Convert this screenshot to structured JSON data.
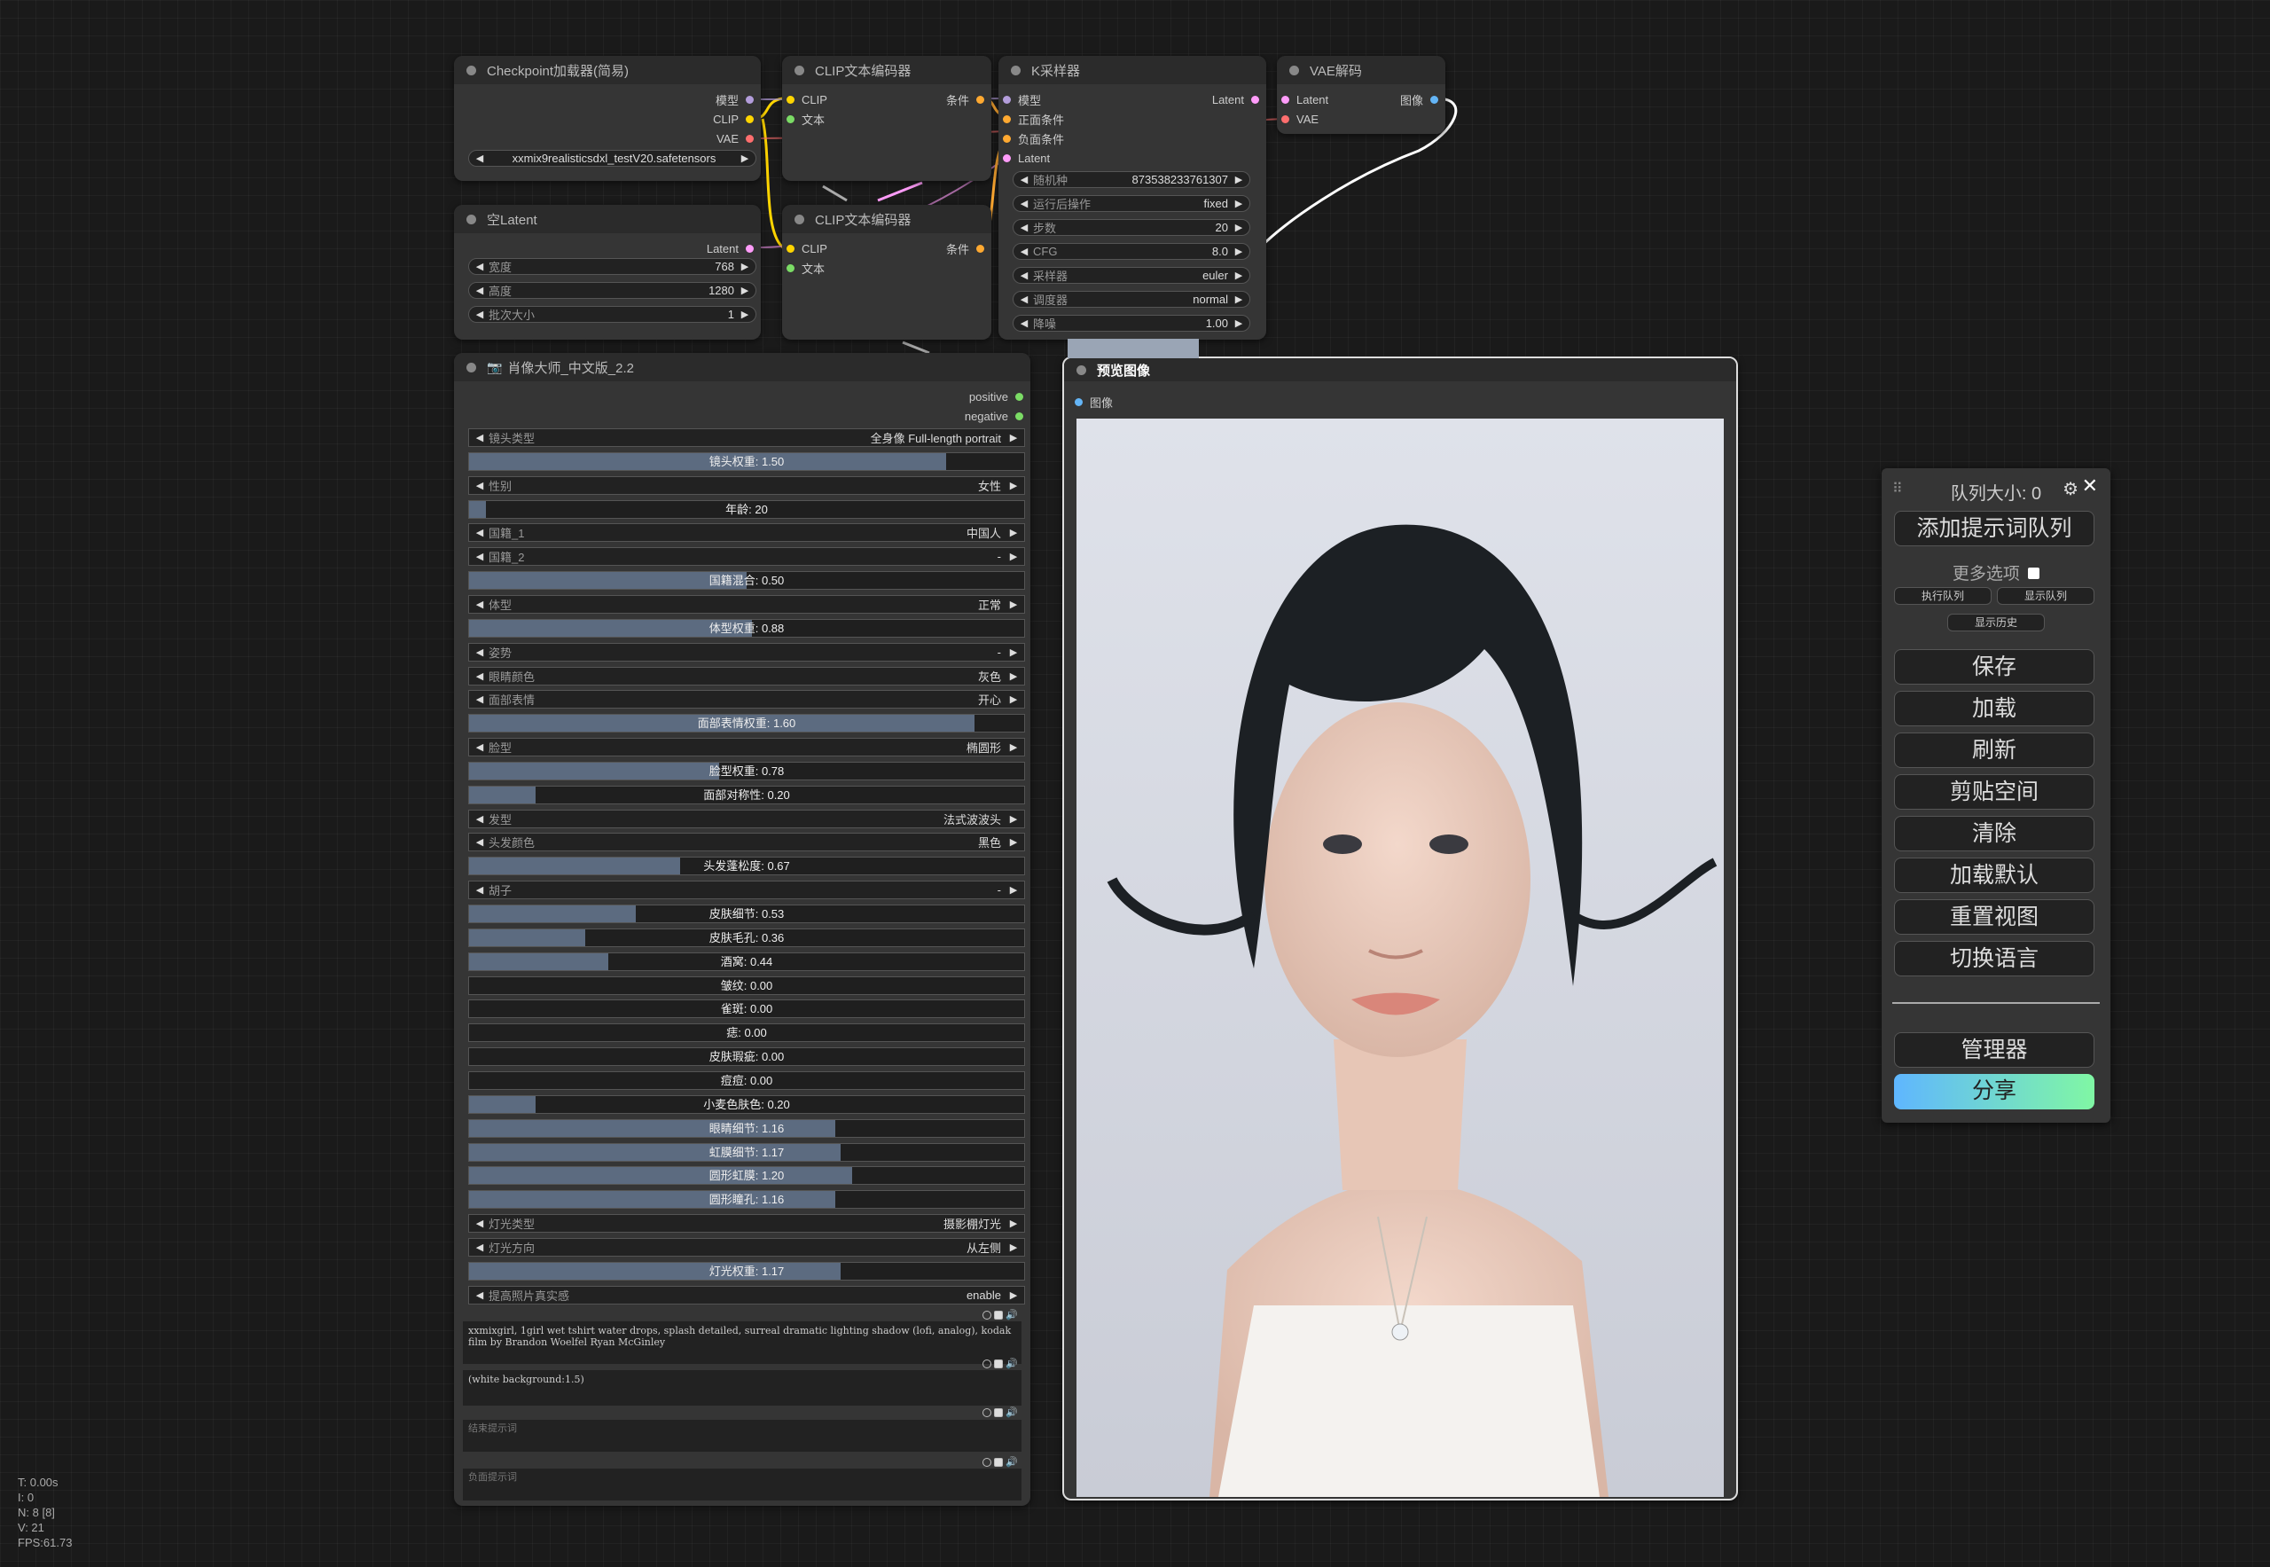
{
  "checkpoint_node": {
    "title": "Checkpoint加载器(简易)",
    "outputs": [
      "模型",
      "CLIP",
      "VAE"
    ],
    "ckpt_name": "xxmix9realisticsdxl_testV20.safetensors"
  },
  "clip_node_1": {
    "title": "CLIP文本编码器",
    "input_clip": "CLIP",
    "input_text": "文本",
    "output": "条件"
  },
  "clip_node_2": {
    "title": "CLIP文本编码器",
    "input_clip": "CLIP",
    "input_text": "文本",
    "output": "条件"
  },
  "ksampler_node": {
    "title": "K采样器",
    "inputs": [
      "模型",
      "正面条件",
      "负面条件",
      "Latent"
    ],
    "output": "Latent",
    "widgets": [
      {
        "label": "随机种",
        "value": "873538233761307"
      },
      {
        "label": "运行后操作",
        "value": "fixed"
      },
      {
        "label": "步数",
        "value": "20"
      },
      {
        "label": "CFG",
        "value": "8.0"
      },
      {
        "label": "采样器",
        "value": "euler"
      },
      {
        "label": "调度器",
        "value": "normal"
      },
      {
        "label": "降噪",
        "value": "1.00"
      }
    ]
  },
  "vae_node": {
    "title": "VAE解码",
    "inputs": [
      "Latent",
      "VAE"
    ],
    "output": "图像"
  },
  "latent_node": {
    "title": "空Latent",
    "output": "Latent",
    "widgets": [
      {
        "label": "宽度",
        "value": "768"
      },
      {
        "label": "高度",
        "value": "1280"
      },
      {
        "label": "批次大小",
        "value": "1"
      }
    ]
  },
  "portrait_node": {
    "title": "肖像大师_中文版_2.2",
    "outputs": [
      "positive",
      "negative"
    ],
    "rows": [
      {
        "kind": "combo",
        "label": "镜头类型",
        "value": "全身像 Full-length portrait"
      },
      {
        "kind": "slider",
        "text": "镜头权重: 1.50",
        "fill": 0.86
      },
      {
        "kind": "combo",
        "label": "性别",
        "value": "女性"
      },
      {
        "kind": "slider",
        "text": "年龄: 20",
        "fill": 0.03
      },
      {
        "kind": "combo",
        "label": "国籍_1",
        "value": "中国人"
      },
      {
        "kind": "combo",
        "label": "国籍_2",
        "value": "-"
      },
      {
        "kind": "slider",
        "text": "国籍混合: 0.50",
        "fill": 0.5
      },
      {
        "kind": "combo",
        "label": "体型",
        "value": "正常"
      },
      {
        "kind": "slider",
        "text": "体型权重: 0.88",
        "fill": 0.51
      },
      {
        "kind": "combo",
        "label": "姿势",
        "value": "-"
      },
      {
        "kind": "combo",
        "label": "眼睛颜色",
        "value": "灰色"
      },
      {
        "kind": "combo",
        "label": "面部表情",
        "value": "开心"
      },
      {
        "kind": "slider",
        "text": "面部表情权重: 1.60",
        "fill": 0.91
      },
      {
        "kind": "combo",
        "label": "脸型",
        "value": "椭圆形"
      },
      {
        "kind": "slider",
        "text": "脸型权重: 0.78",
        "fill": 0.45
      },
      {
        "kind": "slider",
        "text": "面部对称性: 0.20",
        "fill": 0.12
      },
      {
        "kind": "combo",
        "label": "发型",
        "value": "法式波波头"
      },
      {
        "kind": "combo",
        "label": "头发颜色",
        "value": "黑色"
      },
      {
        "kind": "slider",
        "text": "头发蓬松度: 0.67",
        "fill": 0.38
      },
      {
        "kind": "combo",
        "label": "胡子",
        "value": "-"
      },
      {
        "kind": "slider",
        "text": "皮肤细节: 0.53",
        "fill": 0.3
      },
      {
        "kind": "slider",
        "text": "皮肤毛孔: 0.36",
        "fill": 0.21
      },
      {
        "kind": "slider",
        "text": "酒窝: 0.44",
        "fill": 0.25
      },
      {
        "kind": "slider",
        "text": "皱纹: 0.00",
        "fill": 0.0
      },
      {
        "kind": "slider",
        "text": "雀斑: 0.00",
        "fill": 0.0
      },
      {
        "kind": "slider",
        "text": "痣: 0.00",
        "fill": 0.0
      },
      {
        "kind": "slider",
        "text": "皮肤瑕疵: 0.00",
        "fill": 0.0
      },
      {
        "kind": "slider",
        "text": "痘痘: 0.00",
        "fill": 0.0
      },
      {
        "kind": "slider",
        "text": "小麦色肤色: 0.20",
        "fill": 0.12
      },
      {
        "kind": "slider",
        "text": "眼睛细节: 1.16",
        "fill": 0.66
      },
      {
        "kind": "slider",
        "text": "虹膜细节: 1.17",
        "fill": 0.67
      },
      {
        "kind": "slider",
        "text": "圆形虹膜: 1.20",
        "fill": 0.69
      },
      {
        "kind": "slider",
        "text": "圆形瞳孔: 1.16",
        "fill": 0.66
      },
      {
        "kind": "combo",
        "label": "灯光类型",
        "value": "摄影棚灯光"
      },
      {
        "kind": "combo",
        "label": "灯光方向",
        "value": "从左侧"
      },
      {
        "kind": "slider",
        "text": "灯光权重: 1.17",
        "fill": 0.67
      },
      {
        "kind": "combo",
        "label": "提高照片真实感",
        "value": "enable"
      }
    ],
    "text_prompt_1": "xxmixgirl, 1girl wet tshirt water drops, splash detailed, surreal dramatic lighting shadow (lofi, analog), kodak film by Brandon Woelfel Ryan McGinley",
    "text_prompt_2": "(white background:1.5)",
    "text_prompt_3_placeholder": "结束提示词",
    "text_prompt_4_placeholder": "负面提示词"
  },
  "preview_node": {
    "title": "预览图像",
    "input": "图像"
  },
  "queue_panel": {
    "queue_label": "队列大小: 0",
    "add_button": "添加提示词队列",
    "more_options": "更多选项",
    "execute_queue": "执行队列",
    "show_queue": "显示队列",
    "show_history": "显示历史",
    "buttons": [
      "保存",
      "加载",
      "刷新",
      "剪贴空间",
      "清除",
      "加载默认",
      "重置视图",
      "切换语言"
    ],
    "manager": "管理器",
    "share": "分享"
  },
  "stats": [
    "T: 0.00s",
    "I: 0",
    "N: 8 [8]",
    "V: 21",
    "FPS:61.73"
  ],
  "colors": {
    "slider_fill": "#5c6b80",
    "node_bg": "#353535",
    "clip_link": "#ffd500",
    "latent_link": "#ff9cf9",
    "vae_link": "#ff6e6e",
    "image_link": "#64b5f6",
    "cond_link": "#ffa931"
  },
  "icons": [
    "gear-icon",
    "close-icon",
    "drag-handle-icon",
    "chevron-left-icon",
    "chevron-right-icon"
  ]
}
